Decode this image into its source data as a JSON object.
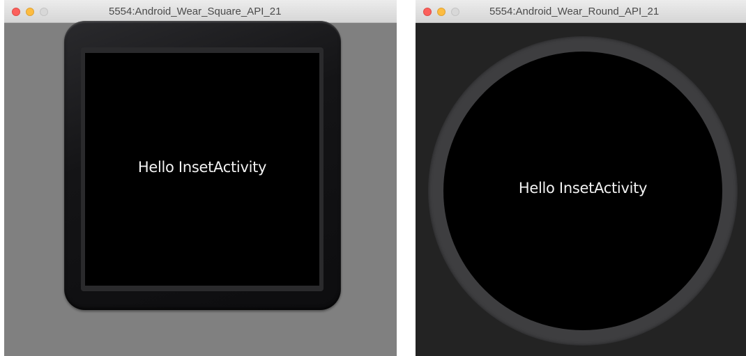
{
  "windows": {
    "square": {
      "title": "5554:Android_Wear_Square_API_21",
      "screen_text": "Hello InsetActivity"
    },
    "round": {
      "title": "5554:Android_Wear_Round_API_21",
      "screen_text": "Hello InsetActivity"
    }
  },
  "colors": {
    "close": "#fc605c",
    "minimize": "#fdbc40",
    "maximize_disabled": "#d8d8d8",
    "square_window_bg": "#808080",
    "round_window_bg": "#232323",
    "screen_bg": "#000000",
    "screen_text": "#f2f2f2"
  },
  "icons": {
    "close": "close-button-icon",
    "minimize": "minimize-button-icon",
    "maximize": "zoom-button-icon"
  }
}
